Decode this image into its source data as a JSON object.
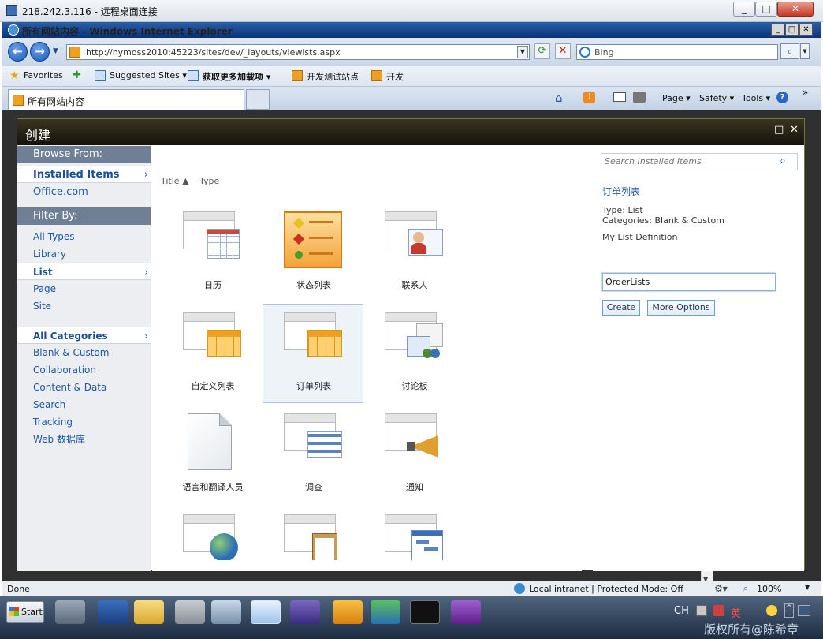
{
  "rdp": {
    "title": "218.242.3.116 - 远程桌面连接",
    "btn_min": "_",
    "btn_max": "□",
    "btn_close": "✕"
  },
  "ie": {
    "title": "所有网站内容 - Windows Internet Explorer",
    "btn_min": "_",
    "btn_max": "□",
    "btn_close": "✕",
    "address": "http://nymoss2010:45223/sites/dev/_layouts/viewlsts.aspx",
    "search_placeholder": "Bing",
    "favorites": {
      "label": "Favorites",
      "items": [
        "Suggested Sites ▾",
        "获取更多加载项 ▾",
        "开发测试站点",
        "开发"
      ]
    },
    "tab_title": "所有网站内容",
    "commands": {
      "page": "Page ▾",
      "safety": "Safety ▾",
      "tools": "Tools ▾",
      "help": "?",
      "more": "»"
    }
  },
  "dialog": {
    "title": "创建",
    "btn_max": "□",
    "btn_close": "✕",
    "browse_from": {
      "header": "Browse From:",
      "items": [
        "Installed Items",
        "Office.com"
      ]
    },
    "filter_by": {
      "header": "Filter By:",
      "types": [
        "All Types",
        "Library",
        "List",
        "Page",
        "Site"
      ]
    },
    "categories": [
      "All Categories",
      "Blank & Custom",
      "Collaboration",
      "Content & Data",
      "Search",
      "Tracking",
      "Web 数据库"
    ],
    "sort": {
      "title": "Title ▲",
      "type": "Type"
    },
    "tiles": [
      {
        "label": "日历",
        "icon": "calendar-list-icon"
      },
      {
        "label": "状态列表",
        "icon": "status-list-icon"
      },
      {
        "label": "联系人",
        "icon": "contacts-list-icon"
      },
      {
        "label": "自定义列表",
        "icon": "custom-list-icon"
      },
      {
        "label": "订单列表",
        "icon": "order-list-icon"
      },
      {
        "label": "讨论板",
        "icon": "discussion-board-icon"
      },
      {
        "label": "语言和翻译人员",
        "icon": "document-icon"
      },
      {
        "label": "调查",
        "icon": "survey-icon"
      },
      {
        "label": "通知",
        "icon": "announcement-icon"
      },
      {
        "label": "",
        "icon": "globe-list-icon"
      },
      {
        "label": "",
        "icon": "clipboard-list-icon"
      },
      {
        "label": "",
        "icon": "project-tasks-icon"
      }
    ],
    "right": {
      "search_placeholder": "Search Installed Items",
      "item_title": "订单列表",
      "type_line": "Type: List",
      "categories_line": "Categories: Blank & Custom",
      "description": "My List Definition",
      "name_value": "OrderLists",
      "create": "Create",
      "more_options": "More Options"
    }
  },
  "status": {
    "left": "Done",
    "zone": "Local intranet | Protected Mode: Off",
    "zoom": "100%"
  },
  "taskbar": {
    "start": "Start",
    "lang": "CH",
    "ime": "英",
    "watermark": "版权所有@陈希章"
  },
  "colors": {
    "accent": "#1d5aa8",
    "nav_header": "#6e7f96",
    "ie_title": "#0a3377"
  }
}
